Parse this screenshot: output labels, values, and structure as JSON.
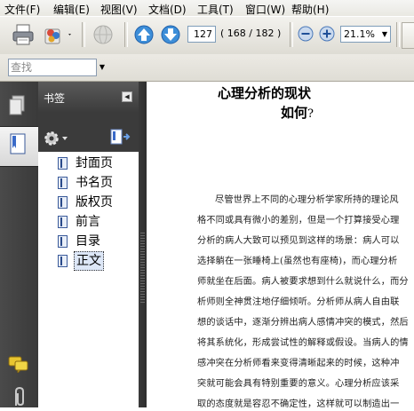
{
  "menu": [
    "文件(F)",
    "编辑(E)",
    "视图(V)",
    "文档(D)",
    "工具(T)",
    "窗口(W)",
    "帮助(H)"
  ],
  "toolbar": {
    "current_page": "127",
    "page_total": "( 168 / 182 )",
    "zoom": "21.1%"
  },
  "find": {
    "placeholder": "查找"
  },
  "nav": {
    "title": "书签",
    "bookmarks": [
      "封面页",
      "书名页",
      "版权页",
      "前言",
      "目录",
      "正文"
    ],
    "selected_index": 5
  },
  "document": {
    "title_line1": "心理分析的现状",
    "title_line2": "如何",
    "title_mark": "?",
    "lines": [
      "尽管世界上不同的心理分析学家所持的理论风",
      "格不同或具有微小的差别，但是一个打算接受心理",
      "分析的病人大致可以预见到这样的场景：病人可以",
      "选择躺在一张睡椅上(虽然也有座椅)，而心理分析",
      "师就坐在后面。病人被要求想到什么就说什么，而分",
      "析师则全神贯注地仔细倾听。分析师从病人自由联",
      "想的谈话中，逐渐分辨出病人感情冲突的模式，然后",
      "将其系统化，形成尝试性的解释或假设。当病人的情",
      "感冲突在分析师看来变得清晰起来的时候，这种冲",
      "突就可能会具有特别重要的意义。心理分析应该采",
      "取的态度就是容忍不确定性，这样就可以制造出一"
    ]
  }
}
